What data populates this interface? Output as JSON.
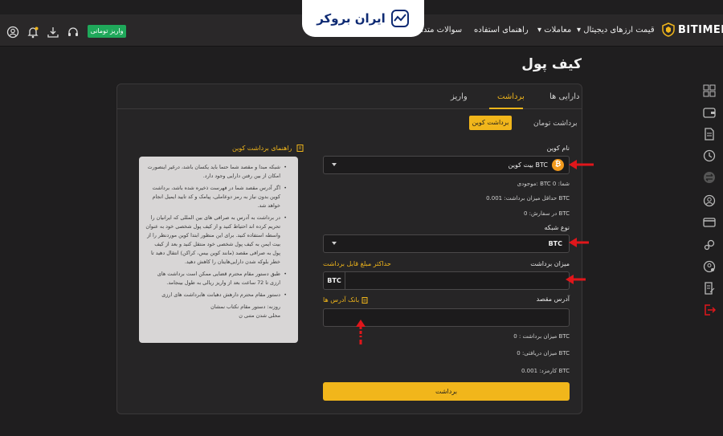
{
  "header": {
    "brand": "BITIMEN",
    "nav": {
      "prices": "قیمت ارزهای دیجیتال",
      "trades": "معاملات",
      "guide": "راهنمای استفاده",
      "faq": "سوالات متداول"
    },
    "deposit_button": "واریز تومانی",
    "watermark_logo": "ایران بروکر"
  },
  "page": {
    "title": "کیف پول"
  },
  "tabs": {
    "assets": "دارایی ها",
    "withdraw": "برداشت",
    "deposit": "واریز"
  },
  "subtabs": {
    "toman": "برداشت تومان",
    "coin": "برداشت کوین"
  },
  "form": {
    "coin_label": "نام کوین",
    "coin_value": "بیت کوین BTC",
    "coin_symbol": "₿",
    "inventory_label": "موجودی:",
    "inventory_coin": "BTC",
    "inventory_unit": "شما:",
    "inventory_value": "0",
    "min_withdraw_label": "حداقل میزان برداشت:",
    "min_withdraw_value": "0.001",
    "in_order_label": "در سفارش:",
    "in_order_value": "0",
    "unit_btc": "BTC",
    "network_label": "نوع شبکه",
    "network_value": "BTC",
    "amount_label": "میزان برداشت",
    "max_amount_link": "حداکثر مبلغ قابل برداشت",
    "amount_unit": "BTC",
    "amount_value": "",
    "address_label": "آدرس مقصد",
    "address_bank_link": "بانک آدرس ها",
    "address_value": "",
    "withdraw_amount_label": "میزان برداشت :",
    "withdraw_amount_value": "0",
    "receive_amount_label": "میزان دریافتی:",
    "receive_amount_value": "0",
    "fee_label": "کارمزد:",
    "fee_value": "0.001",
    "submit": "برداشت"
  },
  "guide": {
    "title": "راهنمای برداشت کوین",
    "items": [
      "شبکه مبدا و مقصد شما حتما باید یکسان باشد، درغیر اینصورت امکان از بین رفتن دارایی وجود دارد.",
      "اگر آدرس مقصد شما در فهرست ذخیره شده باشد، برداشت کوین بدون نیاز به رمز دوعاملی، پیامک و کد تایید ایمیل انجام خواهد شد.",
      "در برداشت به آدرس به صرافی های بین المللی که ایرانیان را تحریم کرده اند احتیاط کنید و از کیف پول شخصی خود به عنوان واسطه استفاده کنید. برای این منظور ابتدا کوین موردنظر را از بیت ایمن به کیف پول شخصی خود منتقل کنید و بعد از کیف پول به صرافی مقصد (مانند کوین بیس، کراکن) انتقال دهید تا خطر بلوکه شدن دارایی‌هایتان را کاهش دهید.",
      "طبق دستور مقام محترم قضایی ممکن است برداشت های ارزی تا 72 ساعت بعد از واریز ریالی به طول بینجامد.",
      "طبق دستور مقام محترم قضایی ممکن است برداشت های ارزی تا 72 ساعت بعد از واریز ریالی به طول بینجامد."
    ],
    "line_a": "دستور مقام محترم دارهش دهبانت هابرداشت های ارزی",
    "line_b": "روزنه:  دستور مقام نکتاب نمشان",
    "line_c": "محلی شدن متنی ن"
  },
  "colors": {
    "accent": "#f1b61b",
    "deposit_green": "#1fa85a",
    "arrow_red": "#e0161b"
  }
}
